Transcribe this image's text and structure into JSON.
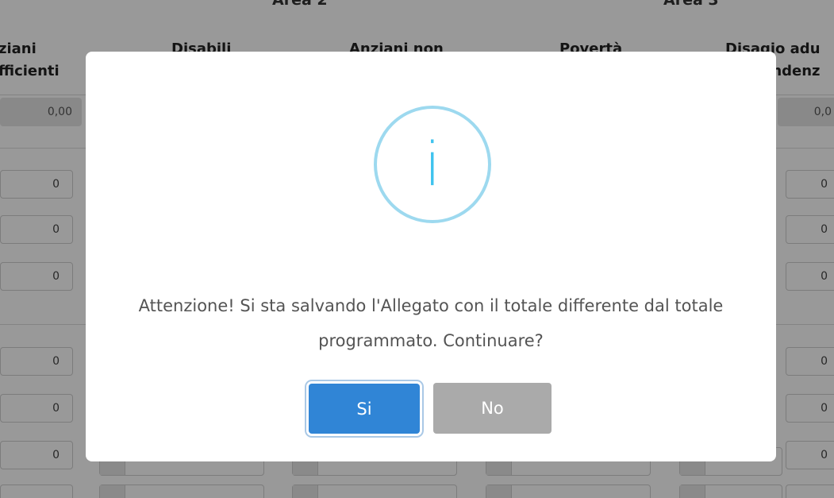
{
  "background": {
    "areas": [
      "Area 2",
      "Area 3"
    ],
    "columns": [
      [
        "ziani",
        "fficienti"
      ],
      [
        "Disabili"
      ],
      [
        "Anziani non"
      ],
      [
        "Povertà"
      ],
      [
        "Disagio adu",
        "ndenz"
      ]
    ],
    "totals": {
      "left": "0,00",
      "right": "0,0"
    },
    "row_value": "0"
  },
  "dialog": {
    "icon": "info-icon",
    "message": "Attenzione! Si sta salvando l'Allegato con il totale differente dal totale programmato. Continuare?",
    "confirm_label": "Si",
    "cancel_label": "No",
    "colors": {
      "confirm": "#3085d6",
      "cancel": "#aaaaaa",
      "icon": "#3fc3ee"
    }
  }
}
